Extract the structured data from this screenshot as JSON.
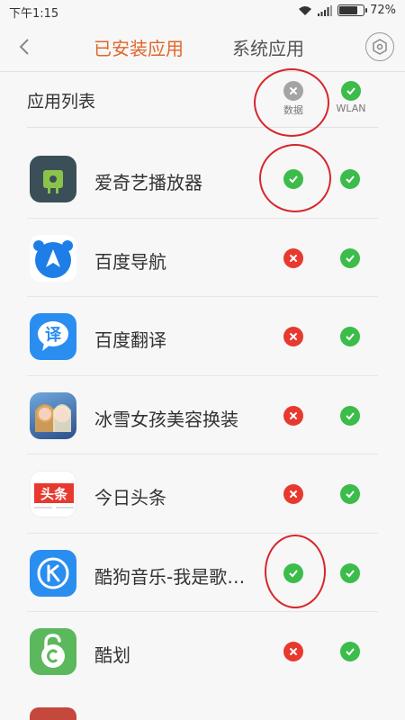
{
  "status": {
    "time": "下午1:15",
    "battery_percent": "72%",
    "battery_level": 0.72
  },
  "nav": {
    "tab_installed": "已安装应用",
    "tab_system": "系统应用"
  },
  "list_header": {
    "title": "应用列表",
    "col_data": "数据",
    "col_wlan": "WLAN"
  },
  "apps": [
    {
      "name": "爱奇艺播放器",
      "data_on": true,
      "wlan_on": true
    },
    {
      "name": "百度导航",
      "data_on": false,
      "wlan_on": true
    },
    {
      "name": "百度翻译",
      "data_on": false,
      "wlan_on": true
    },
    {
      "name": "冰雪女孩美容换装",
      "data_on": false,
      "wlan_on": true
    },
    {
      "name": "今日头条",
      "data_on": false,
      "wlan_on": true
    },
    {
      "name": "酷狗音乐-我是歌…",
      "data_on": true,
      "wlan_on": true
    },
    {
      "name": "酷划",
      "data_on": false,
      "wlan_on": true
    }
  ],
  "icon_text": {
    "translate": "译",
    "toutiao": "头条"
  },
  "colors": {
    "accent": "#e0662a",
    "on": "#3cbc4a",
    "off": "#e8392f",
    "annotation": "#d7262b"
  }
}
